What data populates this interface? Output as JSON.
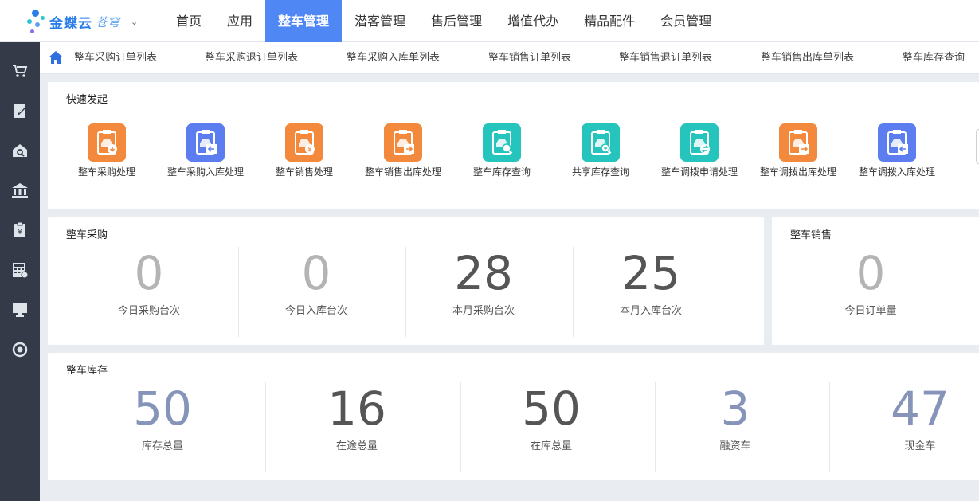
{
  "brand": {
    "name": "金蝶云",
    "product": "苍穹"
  },
  "nav": [
    "首页",
    "应用",
    "整车管理",
    "潜客管理",
    "售后管理",
    "增值代办",
    "精品配件",
    "会员管理"
  ],
  "tabs": [
    "整车采购订单列表",
    "整车采购退订单列表",
    "整车采购入库单列表",
    "整车销售订单列表",
    "整车销售退订单列表",
    "整车销售出库单列表",
    "整车库存查询"
  ],
  "quick": {
    "title": "快速发起",
    "items": [
      {
        "label": "整车采购处理",
        "icon": "car-download-icon",
        "color": "#f2893c"
      },
      {
        "label": "整车采购入库处理",
        "icon": "car-inbound-icon",
        "color": "#5b7df0"
      },
      {
        "label": "整车销售处理",
        "icon": "car-sale-icon",
        "color": "#f2893c"
      },
      {
        "label": "整车销售出库处理",
        "icon": "car-outbound-icon",
        "color": "#f2893c"
      },
      {
        "label": "整车库存查询",
        "icon": "car-search-icon",
        "color": "#25c4bd"
      },
      {
        "label": "共享库存查询",
        "icon": "shared-search-icon",
        "color": "#25c4bd"
      },
      {
        "label": "整车调拨申请处理",
        "icon": "car-transfer-icon",
        "color": "#25c4bd"
      },
      {
        "label": "整车调拨出库处理",
        "icon": "transfer-out-icon",
        "color": "#f2893c"
      },
      {
        "label": "整车调拨入库处理",
        "icon": "transfer-in-icon",
        "color": "#5b7df0"
      }
    ]
  },
  "purchase": {
    "title": "整车采购",
    "stats": [
      {
        "value": "0",
        "label": "今日采购台次"
      },
      {
        "value": "0",
        "label": "今日入库台次"
      },
      {
        "value": "28",
        "label": "本月采购台次"
      },
      {
        "value": "25",
        "label": "本月入库台次"
      }
    ]
  },
  "sales": {
    "title": "整车销售",
    "stats": [
      {
        "value": "0",
        "label": "今日订单量"
      }
    ]
  },
  "inventory": {
    "title": "整车库存",
    "stats": [
      {
        "value": "50",
        "label": "库存总量"
      },
      {
        "value": "16",
        "label": "在途总量"
      },
      {
        "value": "50",
        "label": "在库总量"
      },
      {
        "value": "3",
        "label": "融资车"
      },
      {
        "value": "47",
        "label": "现金车"
      }
    ]
  },
  "colors": {
    "accent": "#4f87f5",
    "sidebar": "#343a47",
    "orange": "#f2893c",
    "blue": "#5b7df0",
    "teal": "#25c4bd"
  }
}
